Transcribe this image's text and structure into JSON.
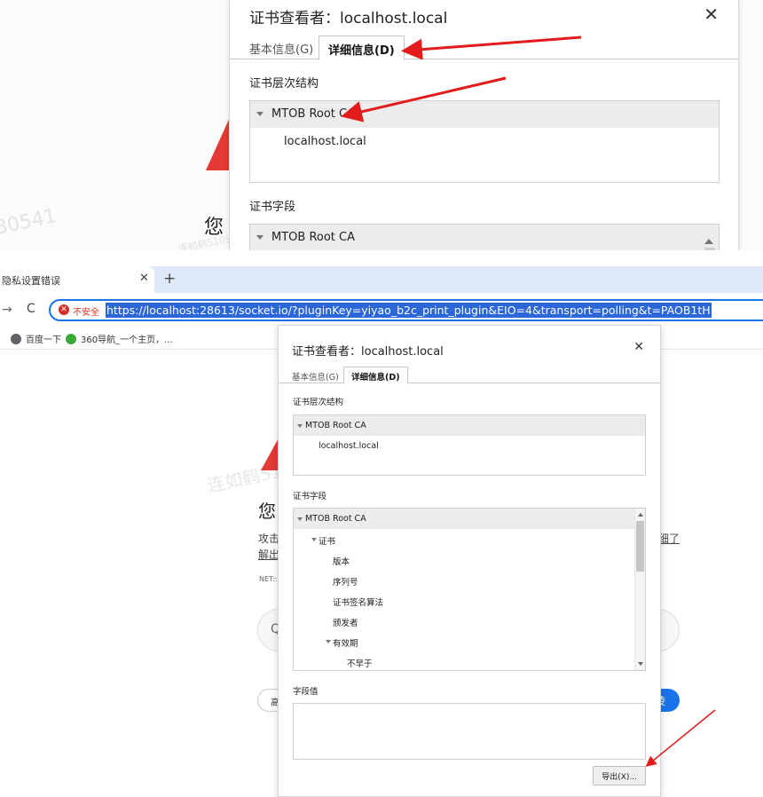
{
  "zoom": {
    "dialog": {
      "title": "证书查看者：localhost.local",
      "close": "✕",
      "tab_basic": "基本信息(G)",
      "tab_detail": "详细信息(D)",
      "hierarchy_label": "证书层次结构",
      "hierarchy_root": "MTOB Root CA",
      "hierarchy_child": "localhost.local",
      "fields_label": "证书字段",
      "fields_root": "MTOB Root CA"
    },
    "page_heading_partial": "您",
    "watermarks": [
      "30541",
      "连知鹤51030541",
      "连知鹤5109248360",
      "连知鹤5109248360"
    ]
  },
  "browser": {
    "tab_title": "隐私设置错误",
    "tab_close": "✕",
    "new_tab": "+",
    "back": "→",
    "reload": "C",
    "insecure_icon": "✕",
    "insecure_label": "不安全",
    "url": "https://localhost:28613/socket.io/?pluginKey=yiyao_b2c_print_plugin&EIO=4&transport=polling&t=PAOB1tH",
    "bookmarks": [
      {
        "label": "百度一下",
        "icon": "globe-icon",
        "color": "#5f6368"
      },
      {
        "label": "360导航_一个主页，...",
        "icon": "360-icon",
        "color": "#3aa935"
      }
    ]
  },
  "page": {
    "heading_partial": "您",
    "line1_partial": "攻击",
    "line2_partial": "解出",
    "link_partial": "细了",
    "net_partial": "NET::",
    "input_icon": "Q",
    "advanced_partial": "高",
    "back_button_partial": "陵",
    "watermark": "连如鹤51030541"
  },
  "dialog": {
    "title": "证书查看者：localhost.local",
    "close": "✕",
    "tab_basic": "基本信息(G)",
    "tab_detail": "详细信息(D)",
    "hierarchy_label": "证书层次结构",
    "hierarchy": [
      {
        "label": "MTOB Root CA",
        "level": 0,
        "expanded": true,
        "selected": true
      },
      {
        "label": "localhost.local",
        "level": 1
      }
    ],
    "fields_label": "证书字段",
    "fields": [
      {
        "label": "MTOB Root CA",
        "level": 0,
        "expanded": true,
        "selected": true
      },
      {
        "label": "证书",
        "level": 1,
        "expanded": true
      },
      {
        "label": "版本",
        "level": 2
      },
      {
        "label": "序列号",
        "level": 2
      },
      {
        "label": "证书签名算法",
        "level": 2
      },
      {
        "label": "颁发者",
        "level": 2
      },
      {
        "label": "有效期",
        "level": 2,
        "expanded": true
      },
      {
        "label": "不早于",
        "level": 3
      }
    ],
    "value_label": "字段值",
    "value_text": "",
    "export_label": "导出(X)..."
  },
  "colors": {
    "annotation_arrow": "#e21b1b",
    "accent": "#1a73e8",
    "insecure": "#d93025"
  }
}
